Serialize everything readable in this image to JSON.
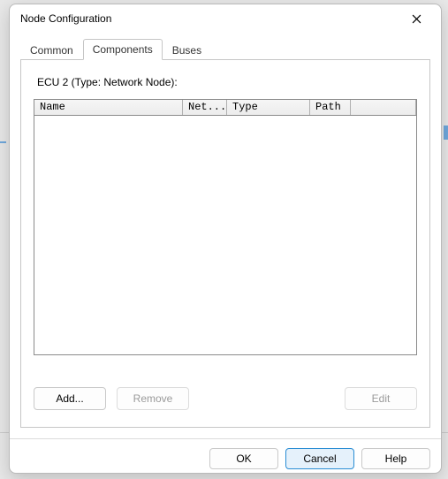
{
  "window": {
    "title": "Node Configuration"
  },
  "tabs": {
    "common": "Common",
    "components": "Components",
    "buses": "Buses",
    "active": "components"
  },
  "panel": {
    "ecu_label": "ECU 2 (Type: Network Node):",
    "columns": {
      "name": "Name",
      "net": "Net...",
      "type": "Type",
      "path": "Path"
    },
    "rows": []
  },
  "buttons": {
    "add": "Add...",
    "remove": "Remove",
    "edit": "Edit",
    "ok": "OK",
    "cancel": "Cancel",
    "help": "Help"
  }
}
